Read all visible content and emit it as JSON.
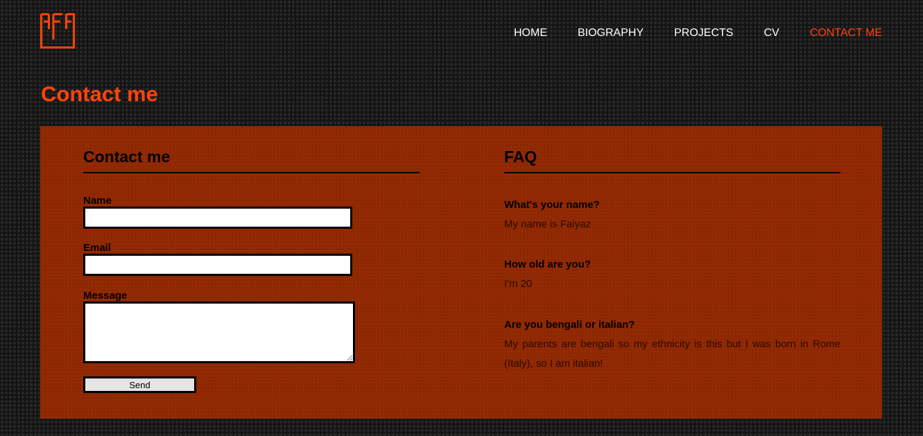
{
  "header": {
    "logo_alt": "FF",
    "nav": [
      {
        "label": "HOME",
        "active": false
      },
      {
        "label": "BIOGRAPHY",
        "active": false
      },
      {
        "label": "PROJECTS",
        "active": false
      },
      {
        "label": "CV",
        "active": false
      },
      {
        "label": "CONTACT ME",
        "active": true
      }
    ]
  },
  "page": {
    "title": "Contact me"
  },
  "contact_form": {
    "title": "Contact me",
    "name_label": "Name",
    "name_value": "",
    "email_label": "Email",
    "email_value": "",
    "message_label": "Message",
    "message_value": "",
    "send_label": "Send"
  },
  "faq": {
    "title": "FAQ",
    "items": [
      {
        "question": "What's your name?",
        "answer": "My name is Faiyaz"
      },
      {
        "question": "How old are you?",
        "answer": "I'm 20"
      },
      {
        "question": "Are you bengali or italian?",
        "answer": "My parents are bengali so my ethnicity is this but I was born in Rome (Italy), so I am italian!"
      }
    ]
  },
  "colors": {
    "accent": "#ff4409",
    "panel": "#942a03",
    "background": "#151515"
  }
}
